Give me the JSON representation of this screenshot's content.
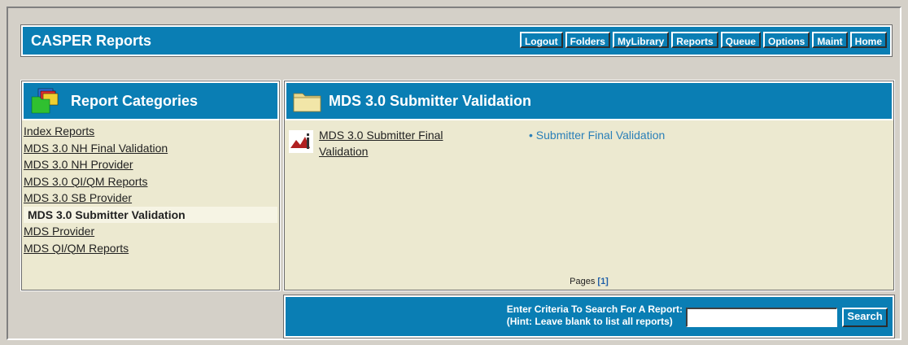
{
  "app": {
    "title": "CASPER Reports"
  },
  "nav": {
    "items": [
      {
        "label": "Logout"
      },
      {
        "label": "Folders"
      },
      {
        "label": "MyLibrary"
      },
      {
        "label": "Reports"
      },
      {
        "label": "Queue"
      },
      {
        "label": "Options"
      },
      {
        "label": "Maint"
      },
      {
        "label": "Home"
      }
    ]
  },
  "categories": {
    "title": "Report Categories",
    "icon": "folders-icon",
    "items": [
      {
        "label": "Index Reports"
      },
      {
        "label": "MDS 3.0 NH Final Validation"
      },
      {
        "label": "MDS 3.0 NH Provider"
      },
      {
        "label": "MDS 3.0 QI/QM Reports"
      },
      {
        "label": "MDS 3.0 SB Provider"
      },
      {
        "label": "MDS 3.0 Submitter Validation",
        "selected": true
      },
      {
        "label": "MDS Provider"
      },
      {
        "label": "MDS QI/QM Reports"
      }
    ]
  },
  "folder": {
    "title": "MDS 3.0 Submitter Validation",
    "icon": "folder-icon",
    "reports": [
      {
        "name": "MDS 3.0 Submitter Final Validation",
        "icon": "report-icon",
        "links": [
          "Submitter Final Validation"
        ]
      }
    ],
    "pages_label": "Pages",
    "pages": "[1]"
  },
  "search": {
    "line1": "Enter Criteria To Search For A Report:",
    "line2": "(Hint: Leave blank to list all reports)",
    "value": "",
    "button": "Search"
  },
  "colors": {
    "header_blue": "#0a7eb4",
    "panel_bg": "#ece9d0",
    "link_blue": "#2a7fb8"
  }
}
